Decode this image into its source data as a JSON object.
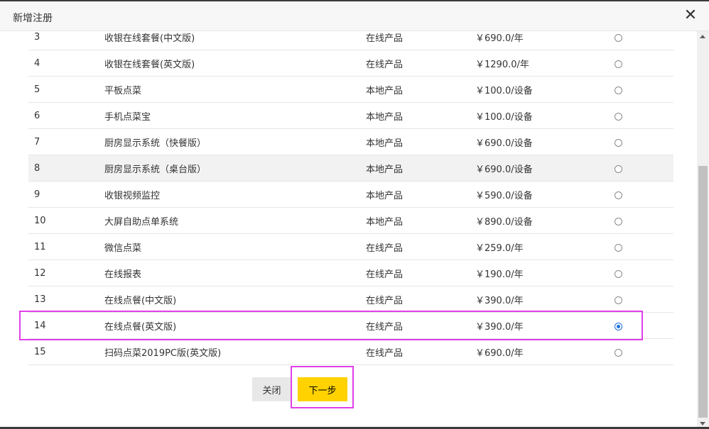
{
  "dialog": {
    "title": "新增注册",
    "close_glyph": "✕"
  },
  "products": [
    {
      "no": "3",
      "name": "收银在线套餐(中文版)",
      "type": "在线产品",
      "price": "￥690.0/年",
      "selected": false
    },
    {
      "no": "4",
      "name": "收银在线套餐(英文版)",
      "type": "在线产品",
      "price": "￥1290.0/年",
      "selected": false
    },
    {
      "no": "5",
      "name": "平板点菜",
      "type": "本地产品",
      "price": "￥100.0/设备",
      "selected": false
    },
    {
      "no": "6",
      "name": "手机点菜宝",
      "type": "本地产品",
      "price": "￥100.0/设备",
      "selected": false
    },
    {
      "no": "7",
      "name": "厨房显示系统（快餐版）",
      "type": "本地产品",
      "price": "￥690.0/设备",
      "selected": false
    },
    {
      "no": "8",
      "name": "厨房显示系统（桌台版）",
      "type": "本地产品",
      "price": "￥690.0/设备",
      "selected": false
    },
    {
      "no": "9",
      "name": "收银视频监控",
      "type": "本地产品",
      "price": "￥590.0/设备",
      "selected": false
    },
    {
      "no": "10",
      "name": "大屏自助点单系统",
      "type": "本地产品",
      "price": "￥890.0/设备",
      "selected": false
    },
    {
      "no": "11",
      "name": "微信点菜",
      "type": "在线产品",
      "price": "￥259.0/年",
      "selected": false
    },
    {
      "no": "12",
      "name": "在线报表",
      "type": "在线产品",
      "price": "￥190.0/年",
      "selected": false
    },
    {
      "no": "13",
      "name": "在线点餐(中文版)",
      "type": "在线产品",
      "price": "￥390.0/年",
      "selected": false
    },
    {
      "no": "14",
      "name": "在线点餐(英文版)",
      "type": "在线产品",
      "price": "￥390.0/年",
      "selected": true
    },
    {
      "no": "15",
      "name": "扫码点菜2019PC版(英文版)",
      "type": "在线产品",
      "price": "￥690.0/年",
      "selected": false
    }
  ],
  "footer": {
    "close_label": "关闭",
    "next_label": "下一步"
  },
  "colors": {
    "accent_next": "#ffd200",
    "highlight": "#e040e8",
    "radio_selected": "#1e6fd9"
  }
}
